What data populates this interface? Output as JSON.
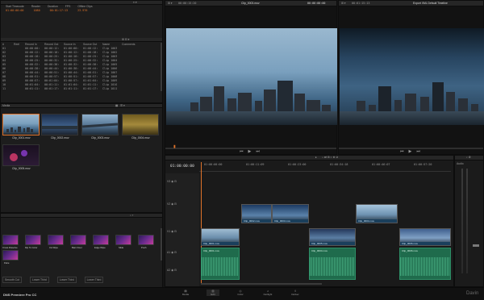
{
  "app": {
    "title": "DaVinci Resolve",
    "footer_left": "DNS Premiere Pro CC",
    "footer_right": "Davin"
  },
  "metadata_header": {
    "labels": [
      "Start Timecode",
      "Reader",
      "Duration",
      "FPS",
      "Offline Clips"
    ],
    "values": [
      "01:00:00:00",
      "1080",
      "00:01:17:13",
      "23.976",
      ""
    ]
  },
  "clip_table": {
    "headers": [
      "#",
      "Reel",
      "Record In",
      "Record Out",
      "Source In",
      "Source Out",
      "Name",
      "Comments"
    ],
    "rows": [
      [
        "01",
        "",
        "00:00:00:00",
        "00:00:12:00",
        "01:00:00:00",
        "01:00:12:00",
        "Clip 1003",
        ""
      ],
      [
        "02",
        "",
        "00:00:12:00",
        "00:00:18:13",
        "01:00:12:00",
        "01:00:18:13",
        "Clip 1002",
        ""
      ],
      [
        "03",
        "",
        "00:00:18:13",
        "00:00:25:04",
        "01:00:18:13",
        "01:00:25:04",
        "Clip 1003",
        ""
      ],
      [
        "04",
        "",
        "00:00:25:04",
        "00:00:32:10",
        "01:00:25:04",
        "01:00:32:10",
        "Clip 1004",
        ""
      ],
      [
        "05",
        "",
        "00:00:32:10",
        "00:00:38:02",
        "01:00:32:10",
        "01:00:38:02",
        "Clip 1005",
        ""
      ],
      [
        "06",
        "",
        "00:00:38:02",
        "00:00:44:19",
        "01:00:38:02",
        "01:00:44:19",
        "Clip 1006",
        ""
      ],
      [
        "07",
        "",
        "00:00:44:19",
        "00:00:51:08",
        "01:00:44:19",
        "01:00:51:08",
        "Clip 1007",
        ""
      ],
      [
        "08",
        "",
        "00:00:51:08",
        "00:00:57:20",
        "01:00:51:08",
        "01:00:57:20",
        "Clip 1008",
        ""
      ],
      [
        "09",
        "",
        "00:00:57:20",
        "00:01:04:11",
        "01:00:57:20",
        "01:01:04:11",
        "Clip 1009",
        ""
      ],
      [
        "10",
        "",
        "00:01:04:11",
        "00:01:11:02",
        "01:01:04:11",
        "01:01:11:02",
        "Clip 1010",
        ""
      ],
      [
        "11",
        "",
        "00:01:11:02",
        "00:01:17:13",
        "01:01:11:02",
        "01:01:17:13",
        "Clip 1011",
        ""
      ]
    ]
  },
  "media_pool": {
    "header": "Media",
    "clips": [
      {
        "name": "Clip_0001.mov"
      },
      {
        "name": "Clip_0002.mov"
      },
      {
        "name": "Clip_0003.mov"
      },
      {
        "name": "Clip_0004.mov"
      },
      {
        "name": "Clip_0005.mov"
      }
    ]
  },
  "effects": {
    "labels": [
      "Cross Dissolve",
      "Dip To Color",
      "Iris Wipe",
      "Barn Door",
      "Edge Wipe",
      "Slide",
      "Push",
      "Flare"
    ],
    "bottom": [
      "Smooth Cut",
      "Lower Third",
      "Lower Third",
      "Lower Third"
    ]
  },
  "source_viewer": {
    "timecode": "00:00:15:20",
    "clip_name": "Clip_0003.mov",
    "right_tc": "00:00:00:00"
  },
  "record_viewer": {
    "timecode": "00:01:15:13",
    "title": "Export XML Default Timeline"
  },
  "timeline": {
    "timecode": "01:00:00:00",
    "ruler": [
      "01:00:00:00",
      "01:00:11:09",
      "01:00:23:00",
      "01:00:34:18",
      "01:00:46:07",
      "01:00:57:20"
    ],
    "video_clips": [
      "Clip_0001.mov",
      "Clip_0002.mov",
      "Clip_0003.mov",
      "Clip_0004.mov",
      "Clip_0005.mov",
      "Clip_0006.mov"
    ],
    "audio_clips": [
      "Clip_0001.mov",
      "Clip_0004.mov",
      "Clip_0006.mov"
    ],
    "tracks": [
      "V3",
      "V2",
      "V1",
      "A1",
      "A2"
    ],
    "mixer_label": "Audio"
  },
  "pages": [
    "Media",
    "Edit",
    "Color",
    "Fairlight",
    "Deliver"
  ],
  "colors": {
    "accent": "#e0732a",
    "audio": "#1f6b4c",
    "video": "#1a3f5c"
  }
}
